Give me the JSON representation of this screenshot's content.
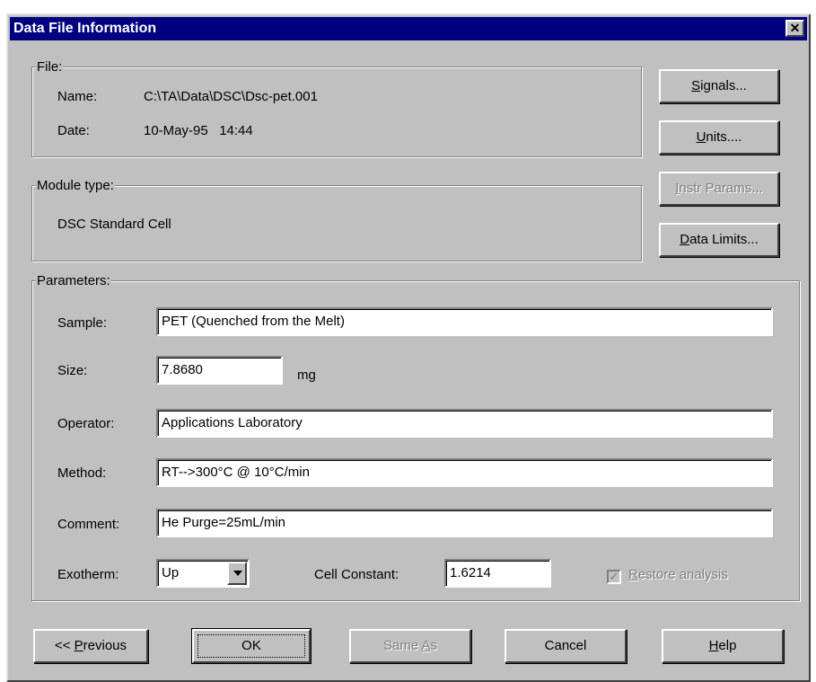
{
  "window": {
    "title": "Data File Information",
    "close_glyph": "✕"
  },
  "file_group": {
    "label": "File:",
    "name_label": "Name:",
    "name_value": "C:\\TA\\Data\\DSC\\Dsc-pet.001",
    "date_label": "Date:",
    "date_value": "10-May-95   14:44"
  },
  "module_group": {
    "label": "Module type:",
    "value": "DSC Standard Cell"
  },
  "side_buttons": {
    "signals": {
      "mnemonic": "S",
      "rest": "ignals..."
    },
    "units": {
      "mnemonic": "U",
      "rest": "nits...."
    },
    "instr_params": {
      "mnemonic": "I",
      "rest": "nstr Params..."
    },
    "data_limits": {
      "mnemonic": "D",
      "rest": "ata Limits..."
    }
  },
  "parameters": {
    "label": "Parameters:",
    "sample_label": "Sample:",
    "sample_value": "PET (Quenched from the Melt)",
    "size_label": "Size:",
    "size_value": "7.8680",
    "size_unit": "mg",
    "operator_label": "Operator:",
    "operator_value": "Applications Laboratory",
    "method_label": "Method:",
    "method_value": "RT-->300°C @ 10°C/min",
    "comment_label": "Comment:",
    "comment_value": "He Purge=25mL/min",
    "exotherm_label": "Exotherm:",
    "exotherm_value": "Up",
    "cell_constant_label": "Cell Constant:",
    "cell_constant_value": "1.6214",
    "restore_mnemonic": "R",
    "restore_rest": "estore analysis",
    "restore_checked": true,
    "check_glyph": "✓"
  },
  "bottom_buttons": {
    "previous": {
      "pre": "<< ",
      "mnemonic": "P",
      "rest": "revious"
    },
    "ok": {
      "label": "OK"
    },
    "same_as": {
      "pre": "Same ",
      "mnemonic": "A",
      "rest": "s"
    },
    "cancel": {
      "label": "Cancel"
    },
    "help": {
      "mnemonic": "H",
      "rest": "elp"
    }
  }
}
